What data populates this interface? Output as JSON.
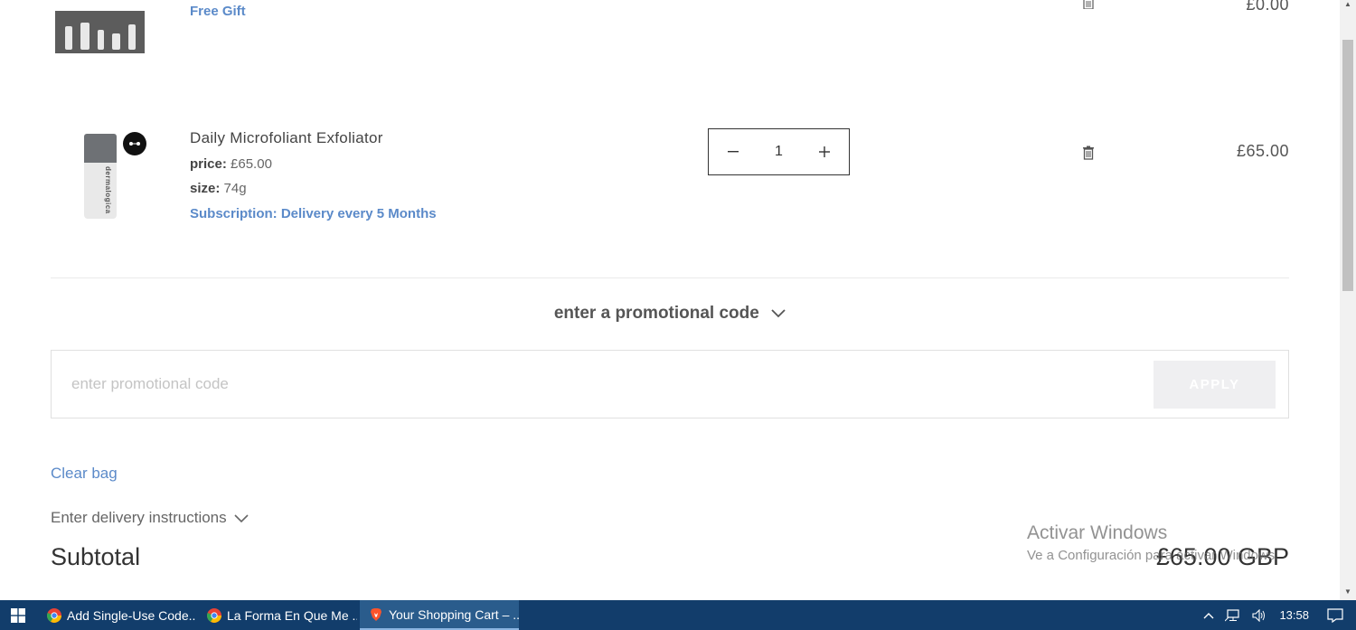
{
  "cart": {
    "items": [
      {
        "tag": "Free Gift",
        "price": "£0.00"
      },
      {
        "name": "Daily Microfoliant Exfoliator",
        "price_label": "price:",
        "price_value": "£65.00",
        "size_label": "size:",
        "size_value": "74g",
        "subscription": "Subscription: Delivery every 5 Months",
        "quantity": "1",
        "line_price": "£65.00",
        "bottle_text": "dermalogica"
      }
    ],
    "promo": {
      "toggle_label": "enter a promotional code",
      "placeholder": "enter promotional code",
      "apply_label": "APPLY"
    },
    "clear_bag": "Clear bag",
    "delivery_instructions": "Enter delivery instructions",
    "subtotal_label": "Subtotal",
    "subtotal_value": "£65.00 GBP"
  },
  "watermark": {
    "title": "Activar Windows",
    "subtitle": "Ve a Configuración para activar Windows."
  },
  "taskbar": {
    "tasks": [
      {
        "label": "Add Single-Use Code...",
        "icon": "chrome-icon"
      },
      {
        "label": "La Forma En Que Me ...",
        "icon": "chrome-icon"
      },
      {
        "label": "Your Shopping Cart – ...",
        "icon": "brave-icon"
      }
    ],
    "clock": "13:58"
  },
  "colors": {
    "link_blue": "#5b8ac9",
    "taskbar": "#123d6b",
    "apply_disabled": "#efeff1"
  }
}
